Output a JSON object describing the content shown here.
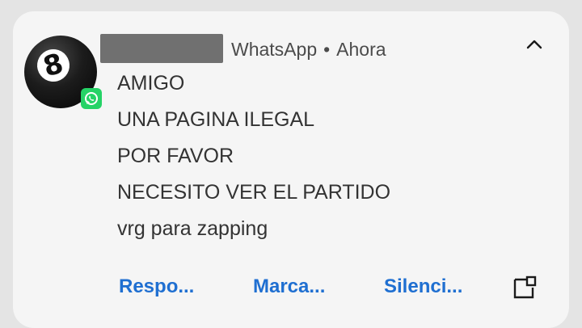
{
  "notification": {
    "app_name": "WhatsApp",
    "separator": "•",
    "time": "Ahora",
    "avatar_digit": "8",
    "message_lines": [
      "AMIGO",
      "UNA PAGINA ILEGAL",
      "POR FAVOR",
      "NECESITO VER EL PARTIDO",
      "vrg para zapping"
    ],
    "actions": {
      "reply": "Respo...",
      "mark_read": "Marca...",
      "mute": "Silenci..."
    }
  },
  "colors": {
    "card_bg": "#f5f5f5",
    "action_text": "#1f6fd1",
    "whatsapp_green": "#25d366",
    "redaction": "#707070"
  },
  "icons": {
    "collapse": "chevron-up-icon",
    "expand": "open-in-window-icon",
    "app_badge": "whatsapp-icon"
  }
}
